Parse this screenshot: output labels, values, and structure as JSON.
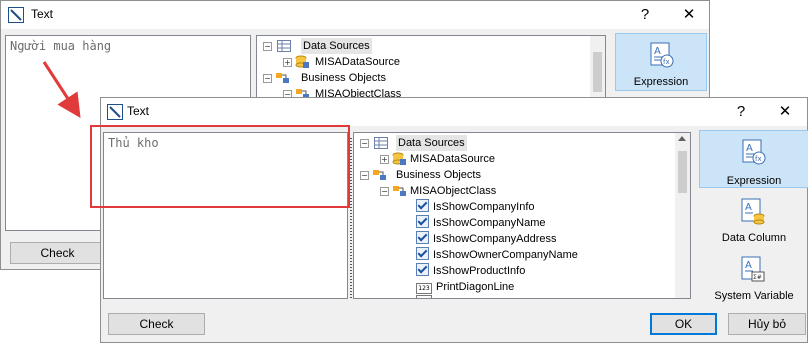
{
  "dialog_back": {
    "title": "Text",
    "help_label": "?",
    "close_label": "✕",
    "text_value": "Người mua hàng",
    "tree": {
      "data_sources": "Data Sources",
      "misa_data_source": "MISADataSource",
      "business_objects": "Business Objects",
      "misa_object_class": "MISAObjectClass"
    },
    "sidebar_expression": "Expression",
    "check_label": "Check"
  },
  "dialog_front": {
    "title": "Text",
    "help_label": "?",
    "close_label": "✕",
    "text_value": "Thủ kho",
    "tree": {
      "data_sources": "Data Sources",
      "misa_data_source": "MISADataSource",
      "business_objects": "Business Objects",
      "misa_object_class": "MISAObjectClass",
      "items": [
        {
          "label": "IsShowCompanyInfo",
          "type": "bool"
        },
        {
          "label": "IsShowCompanyName",
          "type": "bool"
        },
        {
          "label": "IsShowCompanyAddress",
          "type": "bool"
        },
        {
          "label": "IsShowOwnerCompanyName",
          "type": "bool"
        },
        {
          "label": "IsShowProductInfo",
          "type": "bool"
        },
        {
          "label": "PrintDiagonLine",
          "type": "number"
        }
      ]
    },
    "sidebar": {
      "expression": "Expression",
      "data_column": "Data Column",
      "system_variable": "System Variable"
    },
    "check_label": "Check",
    "ok_label": "OK",
    "cancel_label": "Hủy bỏ"
  },
  "colors": {
    "highlight_red": "#e03a3a",
    "selection_blue": "#cce4f7",
    "primary_border": "#0078d7"
  }
}
